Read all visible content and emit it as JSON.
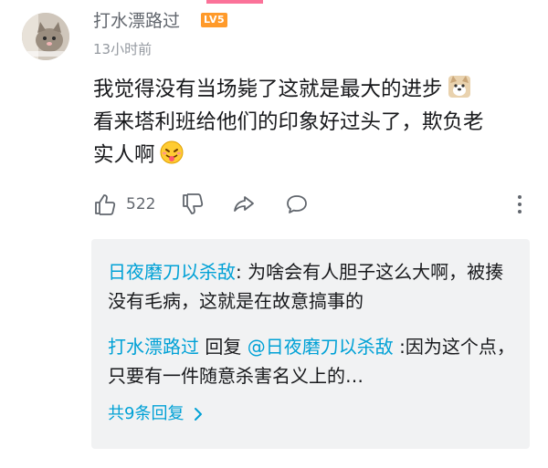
{
  "comment": {
    "username": "打水漂路过",
    "level": "LV5",
    "time": "13小时前",
    "text_line1": "我觉得没有当场毙了这就是最大的进步",
    "text_line2": "看来塔利班给他们的印象好过头了，欺负老",
    "text_line3": "实人啊",
    "likes": "522"
  },
  "replies": [
    {
      "name": "日夜磨刀以杀敌",
      "text": ": 为啥会有人胆子这么大啊，被揍没有毛病，这就是在故意搞事的"
    },
    {
      "name": "打水漂路过",
      "verb": " 回复 ",
      "mention": "@日夜磨刀以杀敌",
      "text": " :因为这个点，只要有一件随意杀害名义上的…"
    }
  ],
  "more_replies": "共9条回复",
  "colors": {
    "link": "#00a1d6",
    "level_badge": "#ff9a2a",
    "accent": "#fb7299"
  },
  "icons": [
    "thumb-up-icon",
    "thumb-down-icon",
    "share-icon",
    "comment-icon",
    "more-vertical-icon",
    "chevron-right-icon"
  ]
}
